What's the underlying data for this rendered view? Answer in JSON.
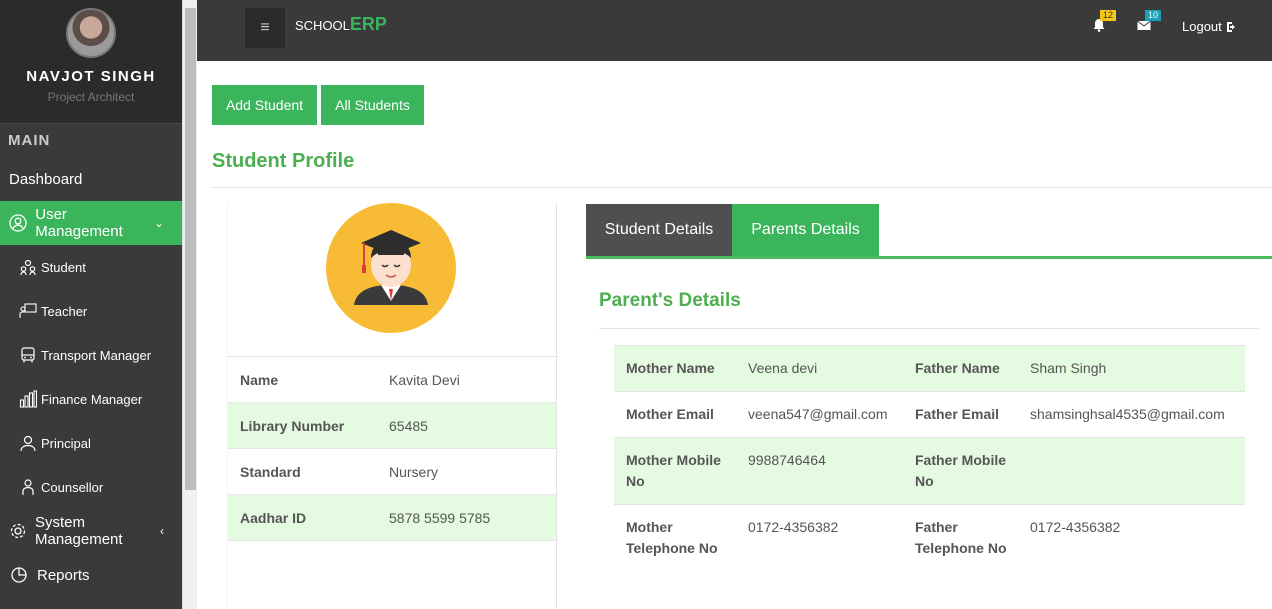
{
  "sidebar": {
    "user_name": "NAVJOT SINGH",
    "user_role": "Project Architect",
    "section_label": "MAIN",
    "items": [
      {
        "label": "Dashboard"
      },
      {
        "label": "User Management"
      },
      {
        "label": "System Management"
      },
      {
        "label": "Reports"
      }
    ],
    "sub_items": [
      {
        "label": "Student"
      },
      {
        "label": "Teacher"
      },
      {
        "label": "Transport Manager"
      },
      {
        "label": "Finance Manager"
      },
      {
        "label": "Principal"
      },
      {
        "label": "Counsellor"
      }
    ]
  },
  "topbar": {
    "brand_prefix": "SCHOOL",
    "brand_suffix": "ERP",
    "notifications_count": "12",
    "messages_count": "10",
    "logout_label": "Logout"
  },
  "actions": {
    "add_student": "Add Student",
    "all_students": "All Students"
  },
  "page_title": "Student Profile",
  "student": {
    "rows": [
      {
        "label": "Name",
        "value": "Kavita Devi"
      },
      {
        "label": "Library Number",
        "value": "65485"
      },
      {
        "label": "Standard",
        "value": "Nursery"
      },
      {
        "label": "Aadhar ID",
        "value": "5878 5599 5785"
      }
    ]
  },
  "tabs": {
    "student_details": "Student Details",
    "parents_details": "Parents Details"
  },
  "parents": {
    "title": "Parent's Details",
    "rows": [
      {
        "l1": "Mother Name",
        "v1": "Veena devi",
        "l2": "Father Name",
        "v2": "Sham Singh"
      },
      {
        "l1": "Mother Email",
        "v1": "veena547@gmail.com",
        "l2": "Father Email",
        "v2": "shamsinghsal4535@gmail.com"
      },
      {
        "l1": "Mother Mobile No",
        "v1": "9988746464",
        "l2": "Father Mobile No",
        "v2": ""
      },
      {
        "l1": "Mother Telephone No",
        "v1": "0172-4356382",
        "l2": "Father Telephone No",
        "v2": "0172-4356382"
      }
    ]
  },
  "colors": {
    "accent_green": "#3bb55c",
    "dark": "#3a3a3a",
    "row_highlight": "#e5fbe1",
    "badge_yellow": "#f5c518",
    "badge_teal": "#17a2b8"
  }
}
